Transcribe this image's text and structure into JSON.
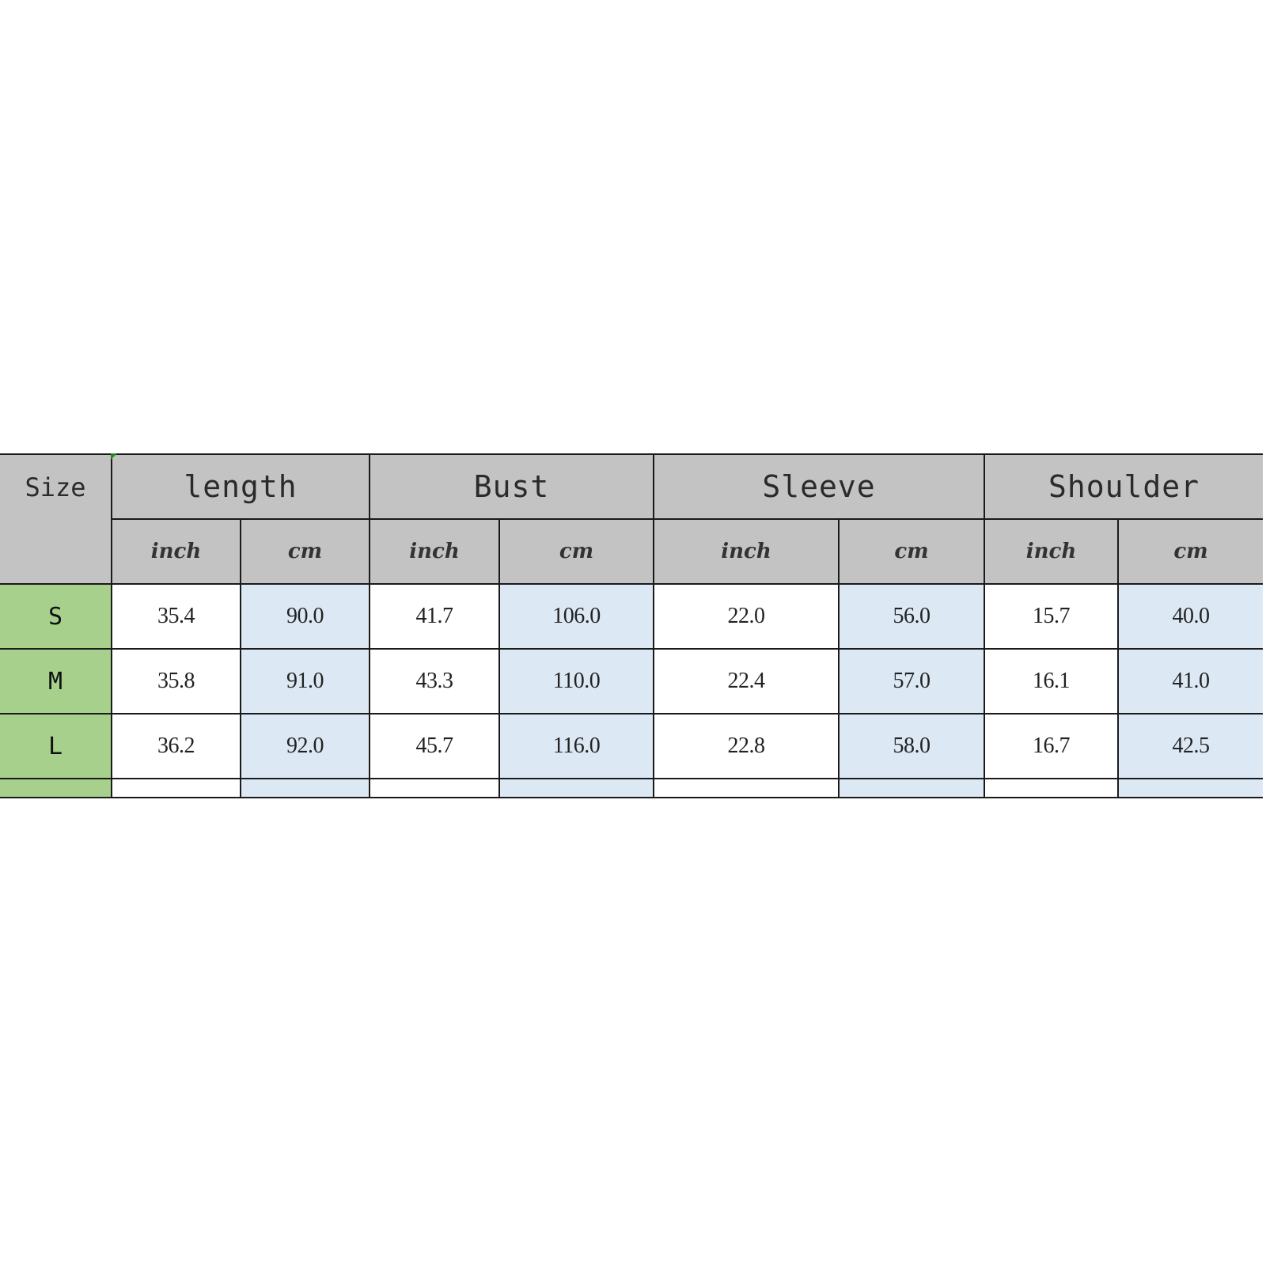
{
  "table": {
    "size_header": "Size",
    "groups": [
      {
        "label": "length",
        "units": [
          "inch",
          "cm"
        ]
      },
      {
        "label": "Bust",
        "units": [
          "inch",
          "cm"
        ]
      },
      {
        "label": "Sleeve",
        "units": [
          "inch",
          "cm"
        ]
      },
      {
        "label": "Shoulder",
        "units": [
          "inch",
          "cm"
        ]
      }
    ],
    "rows": [
      {
        "size": "S",
        "values": [
          "35.4",
          "90.0",
          "41.7",
          "106.0",
          "22.0",
          "56.0",
          "15.7",
          "40.0"
        ]
      },
      {
        "size": "M",
        "values": [
          "35.8",
          "91.0",
          "43.3",
          "110.0",
          "22.4",
          "57.0",
          "16.1",
          "41.0"
        ]
      },
      {
        "size": "L",
        "values": [
          "36.2",
          "92.0",
          "45.7",
          "116.0",
          "22.8",
          "58.0",
          "16.7",
          "42.5"
        ]
      }
    ],
    "colors": {
      "header_bg": "#c3c3c3",
      "size_col_bg": "#a7d08c",
      "cm_col_bg": "#dce9f5",
      "inch_col_bg": "#ffffff",
      "border": "#1a1a1a"
    }
  }
}
